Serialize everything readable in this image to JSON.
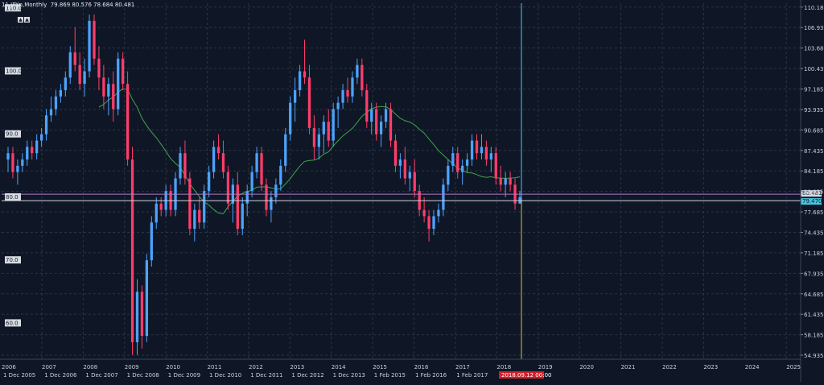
{
  "header": {
    "symbol_prefix": "11.",
    "title": "JPYp,Monthly",
    "ohlc": "79.869 80.576 78.684 80.481",
    "btn_up": "▲",
    "btn_down": "▲"
  },
  "chart_data": {
    "type": "candlestick",
    "timeframe": "Monthly",
    "ylim": [
      54.3,
      110.8
    ],
    "right_axis_ticks": [
      "110.185",
      "106.935",
      "103.685",
      "100.435",
      "97.185",
      "93.935",
      "90.685",
      "87.435",
      "84.185",
      "80.935",
      "77.685",
      "74.435",
      "71.185",
      "67.935",
      "64.685",
      "61.435",
      "58.185",
      "54.935"
    ],
    "left_axis_labels": [
      {
        "label": "110.0",
        "value": 110.0
      },
      {
        "label": "100.0",
        "value": 100.0
      },
      {
        "label": "90.0",
        "value": 90.0
      },
      {
        "label": "80.0",
        "value": 80.0
      },
      {
        "label": "70.0",
        "value": 70.0
      },
      {
        "label": "60.0",
        "value": 60.0
      }
    ],
    "x_labels_top": [
      "2007",
      "2008",
      "2009",
      "2010",
      "2011",
      "2012",
      "2013",
      "2014",
      "2015",
      "2016",
      "2017",
      "2018",
      "2019",
      "2020",
      "2021",
      "2022",
      "2023",
      "2024",
      "2025"
    ],
    "x_labels_bottom": [
      "1 Dec 2005",
      "1 Dec 2006",
      "1 Dec 2007",
      "1 Dec 2008",
      "1 Dec 2009",
      "1 Dec 2010",
      "1 Dec 2011",
      "1 Dec 2012",
      "1 Dec 2013",
      "1 Feb 2015",
      "1 Feb 2016",
      "1 Feb 2017"
    ],
    "bottom_left_label": "2006",
    "current_date_label": "2018.09.12 00:00",
    "price_label_1": "80.481",
    "price_label_2": "79.470",
    "price_label_1_value": 80.481,
    "price_label_2_value": 79.47,
    "colors": {
      "bull": "#4da3ff",
      "bear": "#ff3d6b",
      "ma": "#3fa34a",
      "bg": "#0f1726",
      "grid": "#2b3447",
      "crosshair_v": "#4fc8e8"
    },
    "candles": [
      [
        86,
        88,
        84,
        87
      ],
      [
        87,
        88,
        83,
        84
      ],
      [
        84,
        86,
        82,
        85
      ],
      [
        85,
        87,
        84,
        86
      ],
      [
        86,
        89,
        85,
        88
      ],
      [
        88,
        89,
        86,
        87
      ],
      [
        87,
        90,
        86,
        89
      ],
      [
        89,
        91,
        88,
        90
      ],
      [
        90,
        94,
        89,
        93
      ],
      [
        93,
        96,
        92,
        94
      ],
      [
        94,
        97,
        93,
        96
      ],
      [
        96,
        98,
        95,
        97
      ],
      [
        97,
        100,
        96,
        99
      ],
      [
        99,
        104,
        98,
        103
      ],
      [
        103,
        107,
        100,
        101
      ],
      [
        101,
        103,
        97,
        98
      ],
      [
        98,
        102,
        96,
        100
      ],
      [
        100,
        109,
        99,
        108
      ],
      [
        108,
        109,
        101,
        102
      ],
      [
        102,
        104,
        97,
        99
      ],
      [
        99,
        101,
        94,
        96
      ],
      [
        96,
        99,
        93,
        98
      ],
      [
        98,
        100,
        92,
        94
      ],
      [
        94,
        103,
        93,
        102
      ],
      [
        102,
        103,
        97,
        98
      ],
      [
        98,
        100,
        85,
        86
      ],
      [
        86,
        88,
        55,
        57
      ],
      [
        57,
        67,
        55,
        65
      ],
      [
        65,
        66,
        56,
        58
      ],
      [
        58,
        71,
        57,
        70
      ],
      [
        70,
        77,
        69,
        76
      ],
      [
        76,
        80,
        75,
        79
      ],
      [
        79,
        80,
        77,
        78
      ],
      [
        78,
        82,
        77,
        81
      ],
      [
        81,
        82,
        77,
        78
      ],
      [
        78,
        84,
        77,
        83
      ],
      [
        83,
        88,
        82,
        87
      ],
      [
        87,
        89,
        82,
        83
      ],
      [
        83,
        84,
        74,
        75
      ],
      [
        75,
        79,
        73,
        78
      ],
      [
        78,
        80,
        75,
        76
      ],
      [
        76,
        82,
        75,
        81
      ],
      [
        81,
        85,
        80,
        84
      ],
      [
        84,
        89,
        83,
        88
      ],
      [
        88,
        90,
        86,
        87
      ],
      [
        87,
        89,
        83,
        84
      ],
      [
        84,
        85,
        78,
        79
      ],
      [
        79,
        83,
        76,
        82
      ],
      [
        82,
        84,
        74,
        75
      ],
      [
        75,
        80,
        74,
        79
      ],
      [
        79,
        82,
        77,
        81
      ],
      [
        81,
        85,
        80,
        84
      ],
      [
        84,
        88,
        83,
        87
      ],
      [
        87,
        88,
        81,
        82
      ],
      [
        82,
        83,
        77,
        78
      ],
      [
        78,
        81,
        76,
        80
      ],
      [
        80,
        83,
        79,
        82
      ],
      [
        82,
        86,
        81,
        85
      ],
      [
        85,
        91,
        84,
        90
      ],
      [
        90,
        96,
        89,
        95
      ],
      [
        95,
        99,
        92,
        97
      ],
      [
        97,
        101,
        96,
        100
      ],
      [
        100,
        105,
        98,
        99
      ],
      [
        99,
        101,
        90,
        91
      ],
      [
        91,
        93,
        86,
        88
      ],
      [
        88,
        91,
        86,
        90
      ],
      [
        90,
        93,
        87,
        92
      ],
      [
        92,
        94,
        88,
        89
      ],
      [
        89,
        95,
        88,
        94
      ],
      [
        94,
        96,
        91,
        95
      ],
      [
        95,
        98,
        94,
        97
      ],
      [
        97,
        99,
        95,
        96
      ],
      [
        96,
        100,
        95,
        99
      ],
      [
        99,
        102,
        98,
        101
      ],
      [
        101,
        102,
        96,
        97
      ],
      [
        97,
        98,
        91,
        92
      ],
      [
        92,
        95,
        90,
        94
      ],
      [
        94,
        95,
        89,
        90
      ],
      [
        90,
        93,
        88,
        92
      ],
      [
        92,
        95,
        91,
        94
      ],
      [
        94,
        95,
        88,
        89
      ],
      [
        89,
        90,
        84,
        85
      ],
      [
        85,
        87,
        83,
        86
      ],
      [
        86,
        88,
        82,
        83
      ],
      [
        83,
        85,
        81,
        84
      ],
      [
        84,
        86,
        80,
        81
      ],
      [
        81,
        82,
        77,
        78
      ],
      [
        78,
        80,
        76,
        77
      ],
      [
        77,
        78,
        73,
        75
      ],
      [
        75,
        78,
        74,
        77
      ],
      [
        77,
        79,
        76,
        78
      ],
      [
        78,
        83,
        77,
        82
      ],
      [
        82,
        86,
        81,
        85
      ],
      [
        85,
        88,
        84,
        87
      ],
      [
        87,
        88,
        83,
        84
      ],
      [
        84,
        86,
        82,
        85
      ],
      [
        85,
        87,
        84,
        86
      ],
      [
        86,
        90,
        85,
        89
      ],
      [
        89,
        90,
        86,
        87
      ],
      [
        87,
        90,
        86,
        88
      ],
      [
        88,
        89,
        85,
        86
      ],
      [
        86,
        88,
        84,
        87
      ],
      [
        87,
        88,
        82,
        83
      ],
      [
        83,
        85,
        81,
        82
      ],
      [
        82,
        84,
        80,
        83
      ],
      [
        83,
        84,
        81,
        82
      ],
      [
        82,
        83,
        78,
        79
      ],
      [
        79,
        81,
        79,
        80
      ]
    ]
  }
}
